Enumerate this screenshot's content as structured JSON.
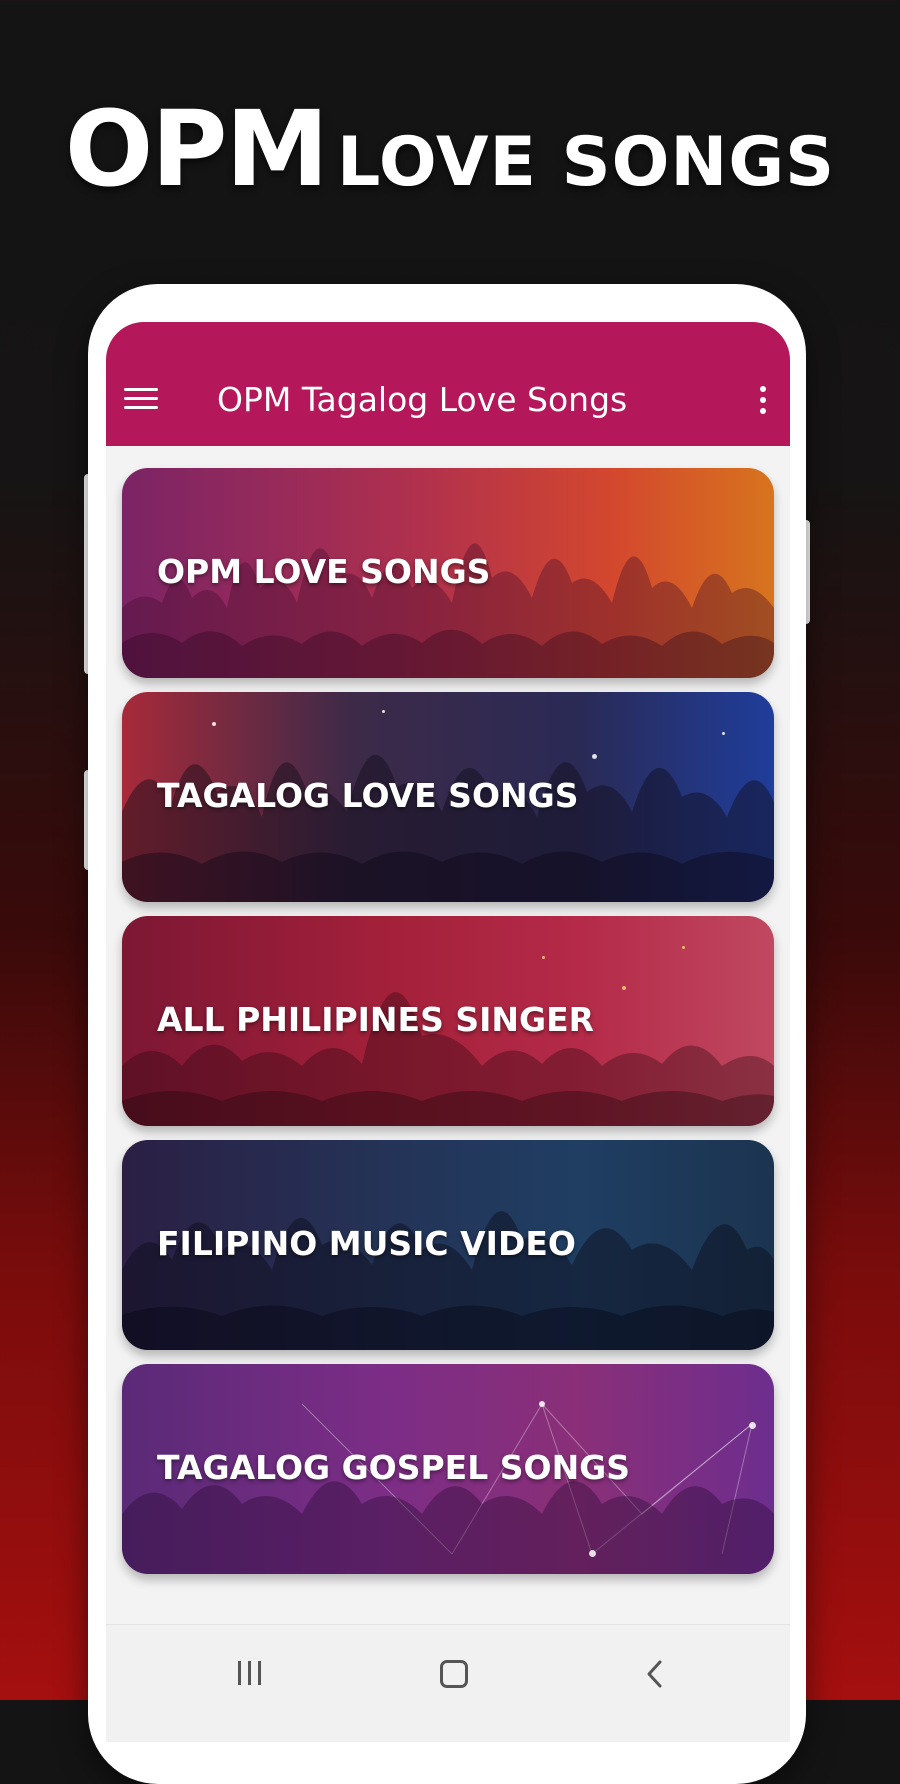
{
  "hero": {
    "title_big": "OPM",
    "title_small": "LOVE SONGS"
  },
  "app": {
    "title": "OPM Tagalog Love Songs",
    "accent_color": "#b5185a",
    "menu_icon": "hamburger-menu-icon",
    "overflow_icon": "more-vert-icon"
  },
  "categories": [
    {
      "label": "OPM LOVE SONGS"
    },
    {
      "label": "TAGALOG LOVE SONGS"
    },
    {
      "label": "ALL PHILIPINES SINGER"
    },
    {
      "label": "FILIPINO MUSIC VIDEO"
    },
    {
      "label": "TAGALOG GOSPEL SONGS"
    }
  ],
  "navbar": {
    "recent_icon": "recent-apps-icon",
    "home_icon": "home-icon",
    "back_icon": "back-icon"
  }
}
